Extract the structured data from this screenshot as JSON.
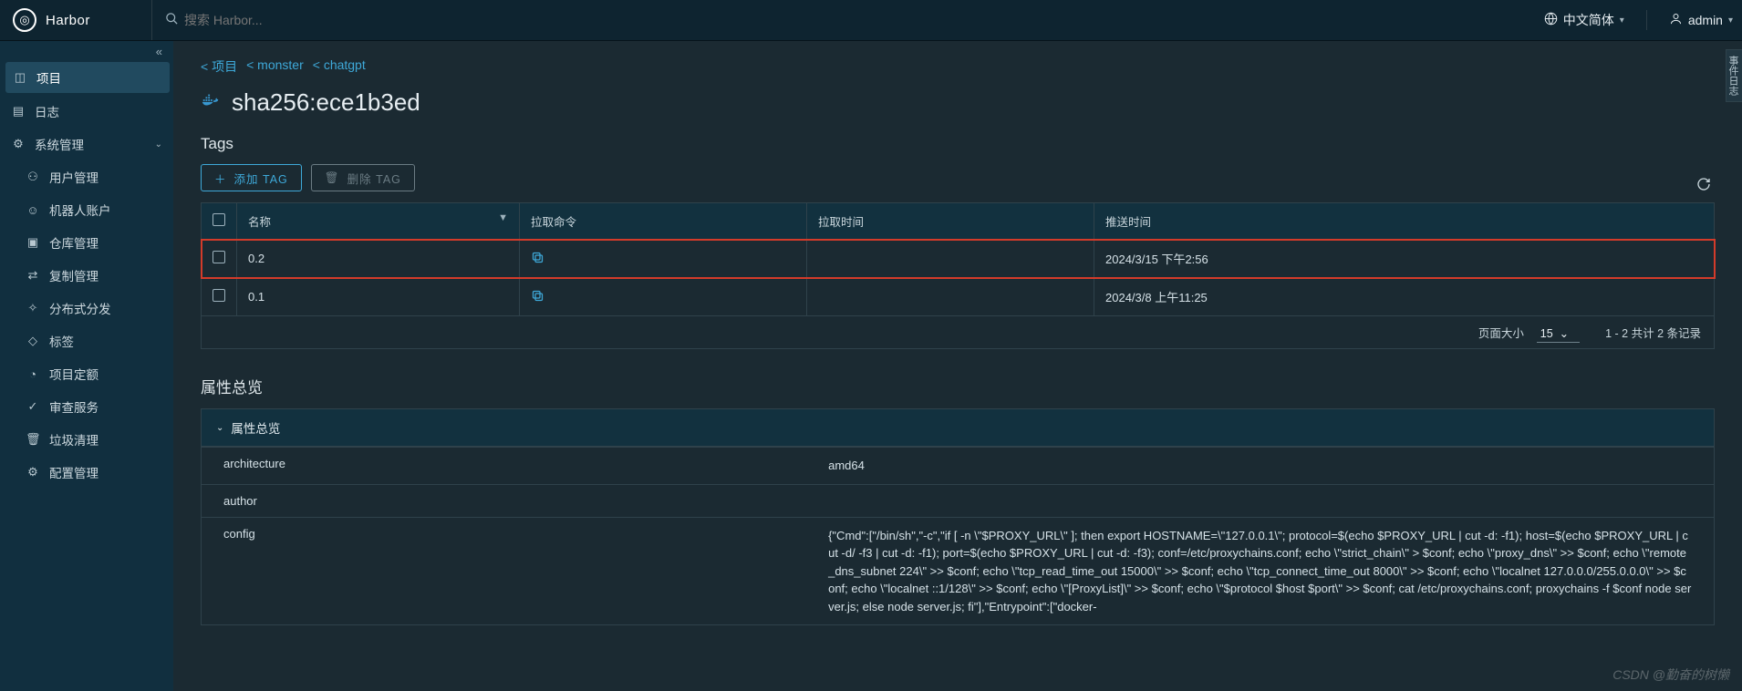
{
  "brand": {
    "name": "Harbor"
  },
  "search": {
    "placeholder": "搜索 Harbor..."
  },
  "header": {
    "language": "中文简体",
    "username": "admin"
  },
  "sidebar": {
    "items": [
      {
        "label": "项目"
      },
      {
        "label": "日志"
      },
      {
        "label": "系统管理"
      },
      {
        "label": "用户管理"
      },
      {
        "label": "机器人账户"
      },
      {
        "label": "仓库管理"
      },
      {
        "label": "复制管理"
      },
      {
        "label": "分布式分发"
      },
      {
        "label": "标签"
      },
      {
        "label": "项目定额"
      },
      {
        "label": "审查服务"
      },
      {
        "label": "垃圾清理"
      },
      {
        "label": "配置管理"
      }
    ]
  },
  "breadcrumbs": [
    {
      "label": "项目"
    },
    {
      "label": "monster"
    },
    {
      "label": "chatgpt"
    }
  ],
  "page": {
    "title": "sha256:ece1b3ed"
  },
  "tags": {
    "heading": "Tags",
    "add_label": "添加 TAG",
    "delete_label": "删除 TAG",
    "cols": {
      "name": "名称",
      "pull_cmd": "拉取命令",
      "pull_time": "拉取时间",
      "push_time": "推送时间"
    },
    "rows": [
      {
        "name": "0.2",
        "push_time": "2024/3/15 下午2:56"
      },
      {
        "name": "0.1",
        "push_time": "2024/3/8 上午11:25"
      }
    ],
    "footer": {
      "page_size_label": "页面大小",
      "page_size_value": "15",
      "range": "1 - 2 共计 2 条记录"
    }
  },
  "attrs": {
    "heading": "属性总览",
    "panel_title": "属性总览",
    "rows": [
      {
        "k": "architecture",
        "v": "amd64"
      },
      {
        "k": "author",
        "v": ""
      },
      {
        "k": "config",
        "v": "{\"Cmd\":[\"/bin/sh\",\"-c\",\"if [ -n \\\"$PROXY_URL\\\" ]; then export HOSTNAME=\\\"127.0.0.1\\\"; protocol=$(echo $PROXY_URL | cut -d: -f1); host=$(echo $PROXY_URL | cut -d/ -f3 | cut -d: -f1); port=$(echo $PROXY_URL | cut -d: -f3); conf=/etc/proxychains.conf; echo \\\"strict_chain\\\" > $conf; echo \\\"proxy_dns\\\" >> $conf; echo \\\"remote_dns_subnet 224\\\" >> $conf; echo \\\"tcp_read_time_out 15000\\\" >> $conf; echo \\\"tcp_connect_time_out 8000\\\" >> $conf; echo \\\"localnet 127.0.0.0/255.0.0.0\\\" >> $conf; echo \\\"localnet ::1/128\\\" >> $conf; echo \\\"[ProxyList]\\\" >> $conf; echo \\\"$protocol $host $port\\\" >> $conf; cat /etc/proxychains.conf; proxychains -f $conf node server.js; else node server.js; fi\"],\"Entrypoint\":[\"docker-"
      }
    ]
  },
  "side_widget": {
    "label": "事件日志"
  },
  "watermark": "CSDN @勤奋的树懒"
}
